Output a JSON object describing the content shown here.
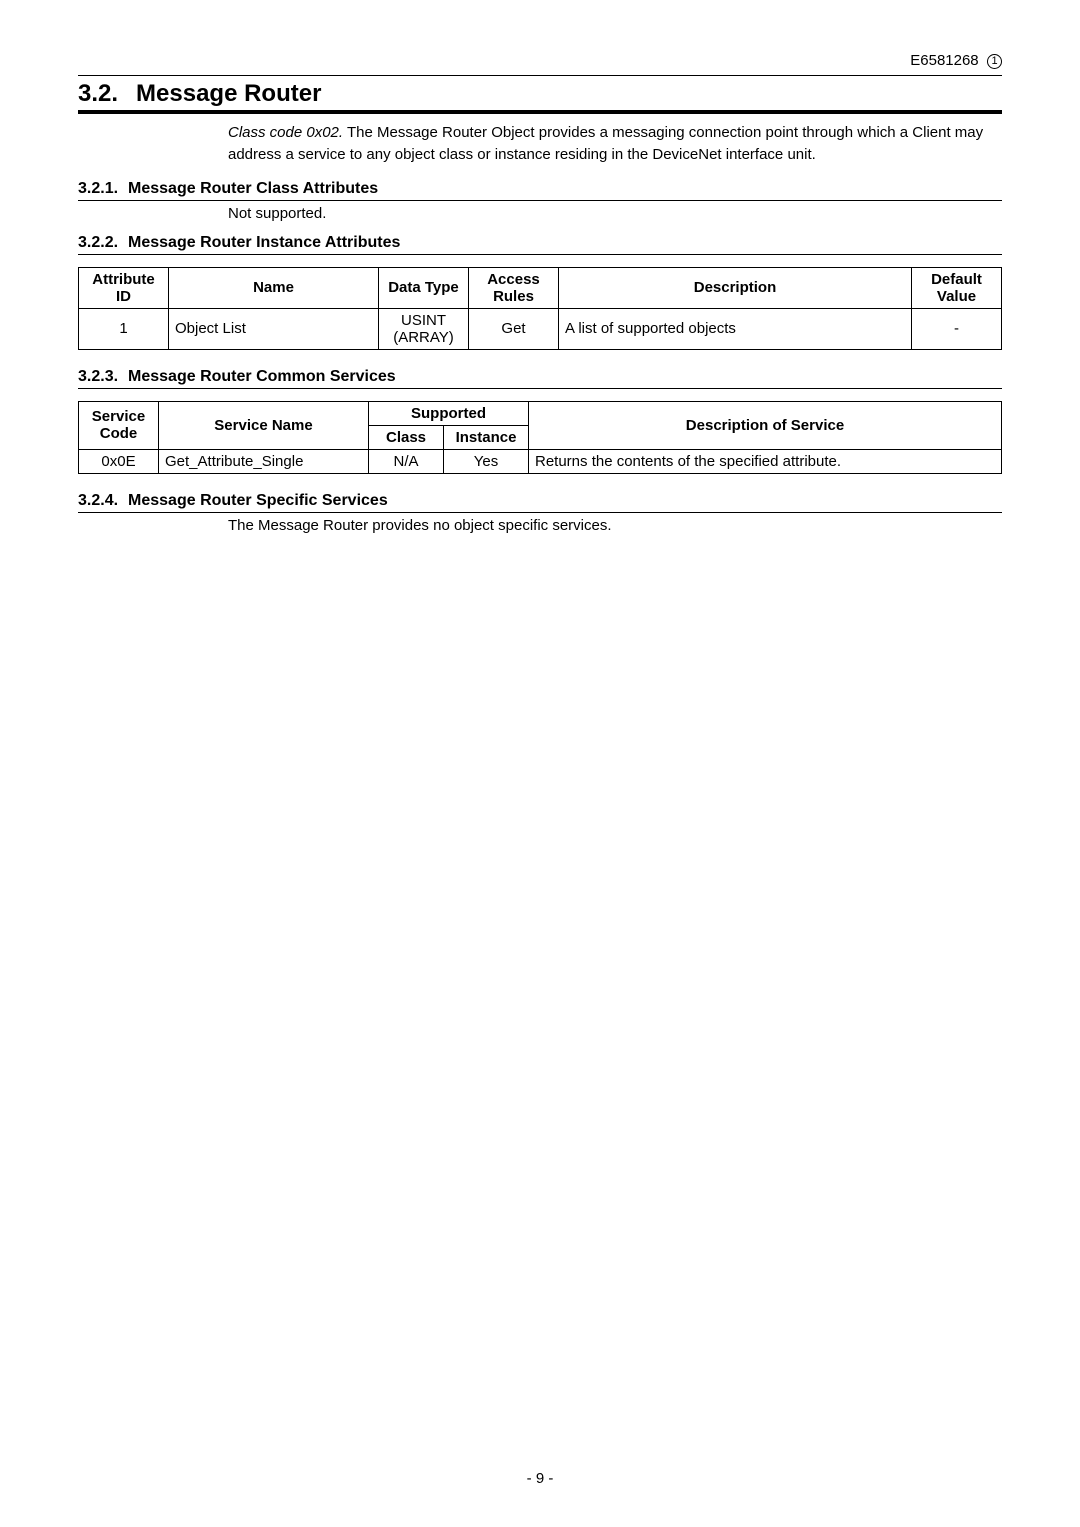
{
  "header": {
    "doc_id": "E6581268",
    "rev": "1"
  },
  "section": {
    "number": "3.2.",
    "title": "Message Router",
    "intro_prefix": "Class code 0x02.",
    "intro_rest": " The Message Router Object provides a messaging connection point through which a Client may address a service to any object class or instance residing in the DeviceNet interface unit."
  },
  "sub1": {
    "num": "3.2.1.",
    "title": "Message Router Class Attributes",
    "body": "Not supported."
  },
  "sub2": {
    "num": "3.2.2.",
    "title": "Message Router Instance Attributes"
  },
  "table1": {
    "h_attr": "Attribute ID",
    "h_name": "Name",
    "h_dtype": "Data Type",
    "h_access": "Access Rules",
    "h_desc": "Description",
    "h_default": "Default Value",
    "rows": [
      {
        "attr": "1",
        "name": "Object List",
        "dtype": "USINT (ARRAY)",
        "access": "Get",
        "desc": "A list of supported objects",
        "default": "-"
      }
    ]
  },
  "sub3": {
    "num": "3.2.3.",
    "title": "Message Router Common Services"
  },
  "table2": {
    "h_code": "Service Code",
    "h_sname": "Service Name",
    "h_supported": "Supported",
    "h_class": "Class",
    "h_instance": "Instance",
    "h_desc": "Description of Service",
    "rows": [
      {
        "code": "0x0E",
        "sname": "Get_Attribute_Single",
        "class_": "N/A",
        "instance": "Yes",
        "desc": "Returns the contents of the specified attribute."
      }
    ]
  },
  "sub4": {
    "num": "3.2.4.",
    "title": "Message Router Specific Services",
    "body": "The Message Router provides no object specific services."
  },
  "footer": {
    "page": "- 9 -"
  }
}
